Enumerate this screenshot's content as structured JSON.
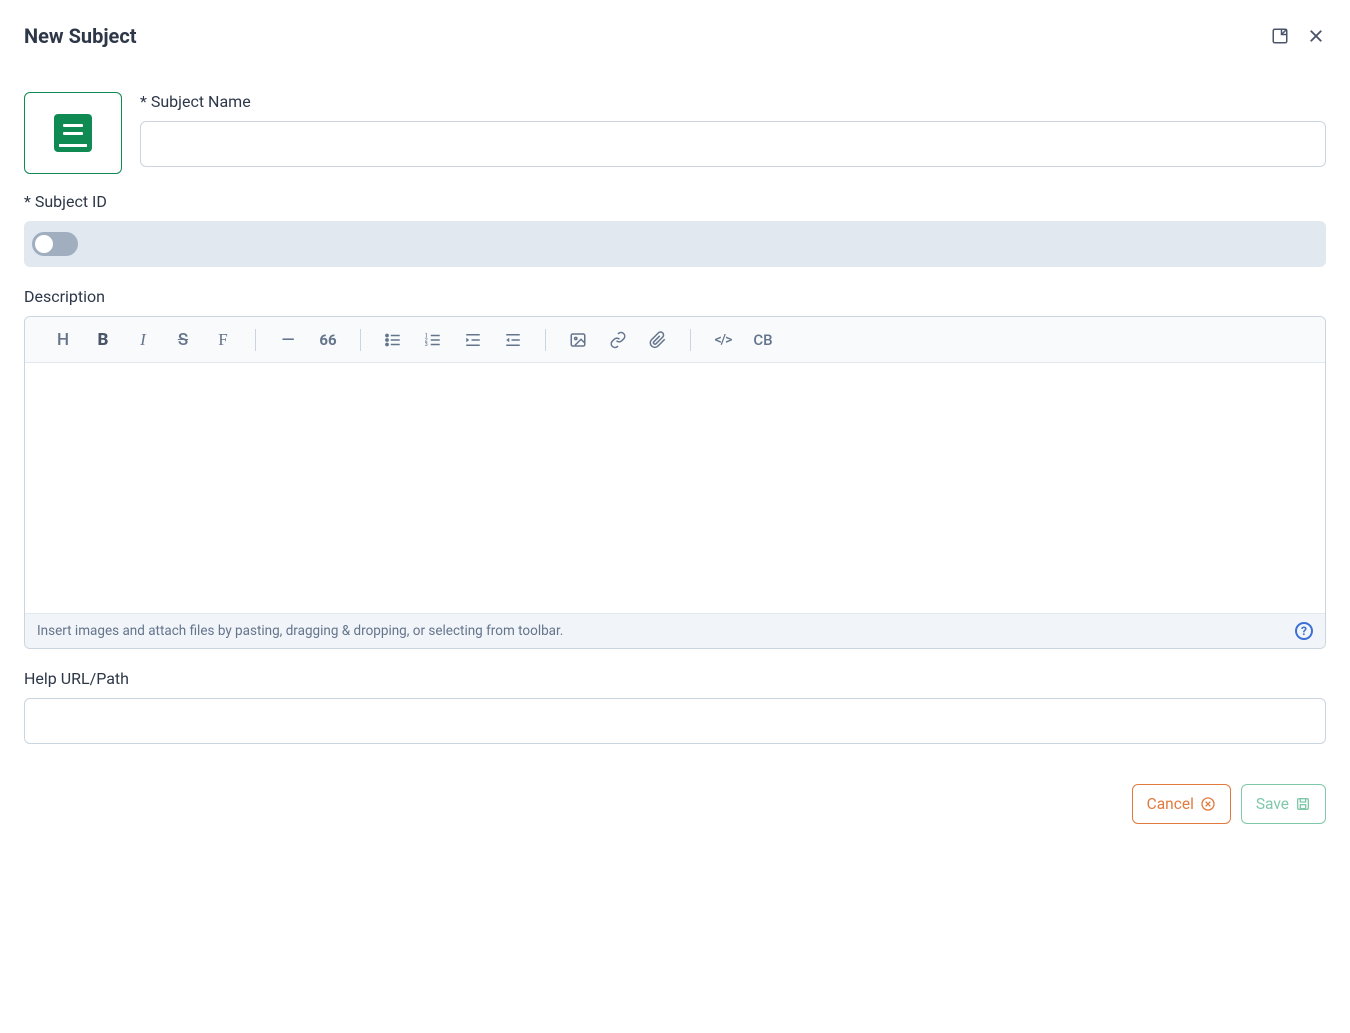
{
  "header": {
    "title": "New Subject"
  },
  "fields": {
    "subjectName": {
      "label": "* Subject Name",
      "value": ""
    },
    "subjectId": {
      "label": "* Subject ID",
      "value": "",
      "toggle": false
    },
    "description": {
      "label": "Description",
      "value": "",
      "footerHint": "Insert images and attach files by pasting, dragging & dropping, or selecting from toolbar."
    },
    "helpUrl": {
      "label": "Help URL/Path",
      "value": ""
    }
  },
  "toolbar": {
    "heading": "H",
    "bold": "B",
    "italic": "I",
    "strike": "S",
    "format": "F",
    "hr": "—",
    "quote": "66",
    "codeInline": "</>",
    "codeBlock": "CB"
  },
  "buttons": {
    "cancel": "Cancel",
    "save": "Save"
  }
}
